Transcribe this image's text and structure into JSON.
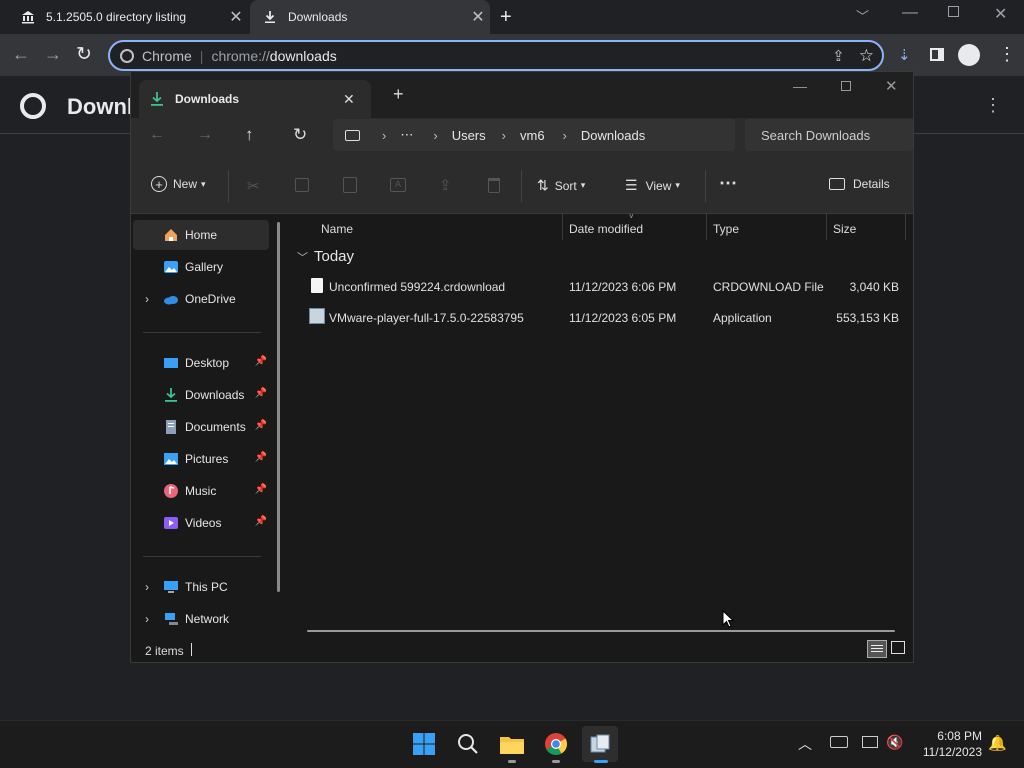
{
  "chrome": {
    "tabs": [
      {
        "title": "5.1.2505.0 directory listing"
      },
      {
        "title": "Downloads"
      }
    ],
    "omnibox": {
      "site": "Chrome",
      "separator": "|",
      "url_prefix": "chrome://",
      "url_host": "downloads"
    },
    "page_title": "Downlo"
  },
  "explorer": {
    "tab_title": "Downloads",
    "breadcrumb": [
      "⋯",
      "Users",
      "vm6",
      "Downloads"
    ],
    "search_placeholder": "Search Downloads",
    "commands": {
      "new": "New",
      "sort": "Sort",
      "view": "View",
      "more": "⋯",
      "details": "Details"
    },
    "nav": {
      "top": [
        {
          "label": "Home"
        },
        {
          "label": "Gallery"
        },
        {
          "label": "OneDrive"
        }
      ],
      "quick": [
        {
          "label": "Desktop"
        },
        {
          "label": "Downloads"
        },
        {
          "label": "Documents"
        },
        {
          "label": "Pictures"
        },
        {
          "label": "Music"
        },
        {
          "label": "Videos"
        }
      ],
      "bottom": [
        {
          "label": "This PC"
        },
        {
          "label": "Network"
        }
      ]
    },
    "columns": [
      "Name",
      "Date modified",
      "Type",
      "Size"
    ],
    "group": "Today",
    "files": [
      {
        "name": "Unconfirmed 599224.crdownload",
        "date": "11/12/2023 6:06 PM",
        "type": "CRDOWNLOAD File",
        "size": "3,040 KB"
      },
      {
        "name": "VMware-player-full-17.5.0-22583795",
        "date": "11/12/2023 6:05 PM",
        "type": "Application",
        "size": "553,153 KB"
      }
    ],
    "status": "2 items"
  },
  "taskbar": {
    "time": "6:08 PM",
    "date": "11/12/2023",
    "apps": [
      "windows-start-icon",
      "search-icon",
      "file-explorer-icon",
      "chrome-icon",
      "vmware-installer-icon"
    ]
  },
  "colors": {
    "accent": "#8ab4f8",
    "explorer_bg": "#191919",
    "win_blue": "#3aa0f3"
  }
}
